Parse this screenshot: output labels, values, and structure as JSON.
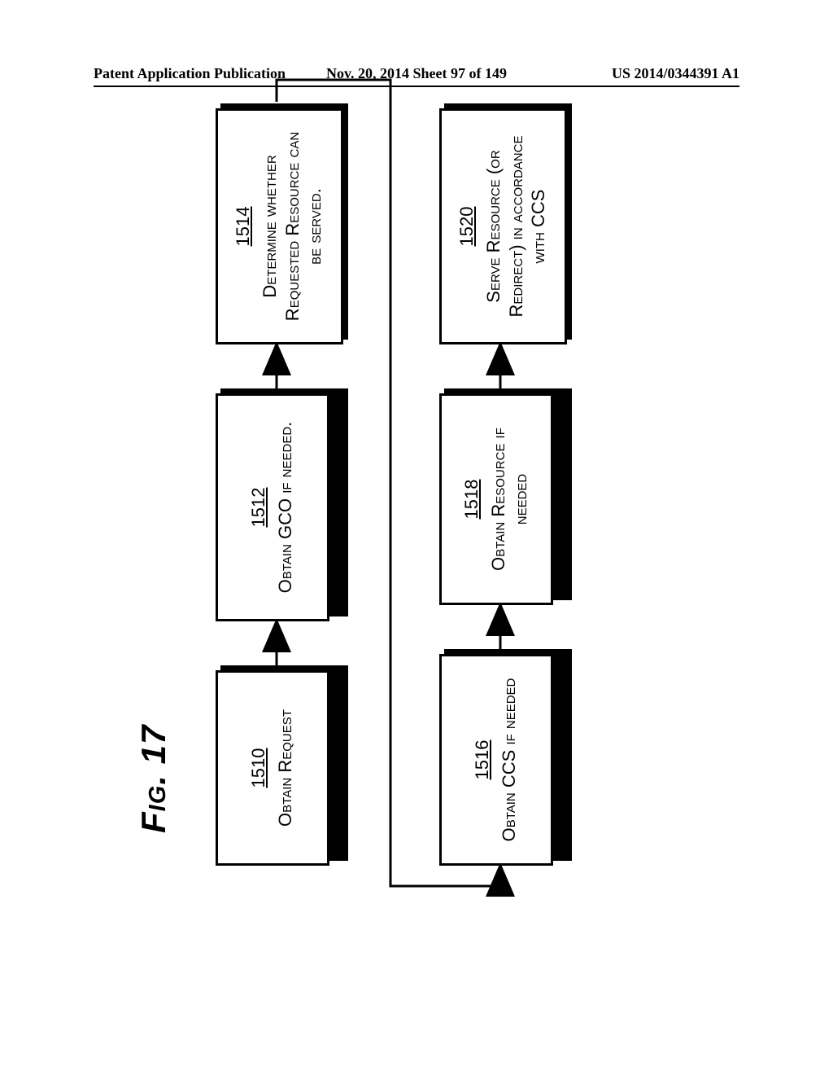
{
  "header": {
    "left": "Patent Application Publication",
    "center": "Nov. 20, 2014  Sheet 97 of 149",
    "right": "US 2014/0344391 A1"
  },
  "figure": {
    "title": "Fig. 17",
    "boxes": {
      "b1510": {
        "num": "1510",
        "text": "Obtain Request"
      },
      "b1512": {
        "num": "1512",
        "text": "Obtain GCO if needed."
      },
      "b1514": {
        "num": "1514",
        "text": "Determine whether Requested Resource can be served."
      },
      "b1516": {
        "num": "1516",
        "text": "Obtain CCS if needed"
      },
      "b1518": {
        "num": "1518",
        "text": "Obtain Resource if needed"
      },
      "b1520": {
        "num": "1520",
        "text": "Serve Resource (or Redirect) in accordance with CCS"
      }
    }
  }
}
